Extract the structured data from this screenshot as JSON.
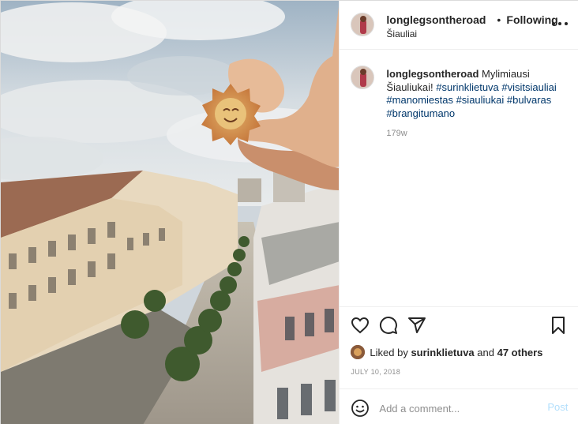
{
  "header": {
    "username": "longlegsontheroad",
    "separator": "•",
    "follow_status": "Following",
    "location": "Šiauliai"
  },
  "caption": {
    "username": "longlegsontheroad",
    "text": "Mylimiausi Šiauliukai!",
    "hashtags": [
      "#surinklietuva",
      "#visitsiauliai",
      "#manomiestas",
      "#siauliukai",
      "#bulvaras",
      "#brangitumano"
    ],
    "age": "179w"
  },
  "likes": {
    "prefix": "Liked by",
    "liker": "surinklietuva",
    "joiner": "and",
    "others": "47 others"
  },
  "date": "JULY 10, 2018",
  "comment": {
    "placeholder": "Add a comment...",
    "post_label": "Post"
  },
  "icons": {
    "more": "more-options-icon",
    "like": "heart-icon",
    "comment": "comment-icon",
    "share": "share-icon",
    "save": "bookmark-icon",
    "emoji": "emoji-icon"
  },
  "colors": {
    "text": "#262626",
    "muted": "#8e8e8e",
    "hashtag": "#00376b",
    "post_disabled": "#b2dffc",
    "border": "#efefef"
  }
}
